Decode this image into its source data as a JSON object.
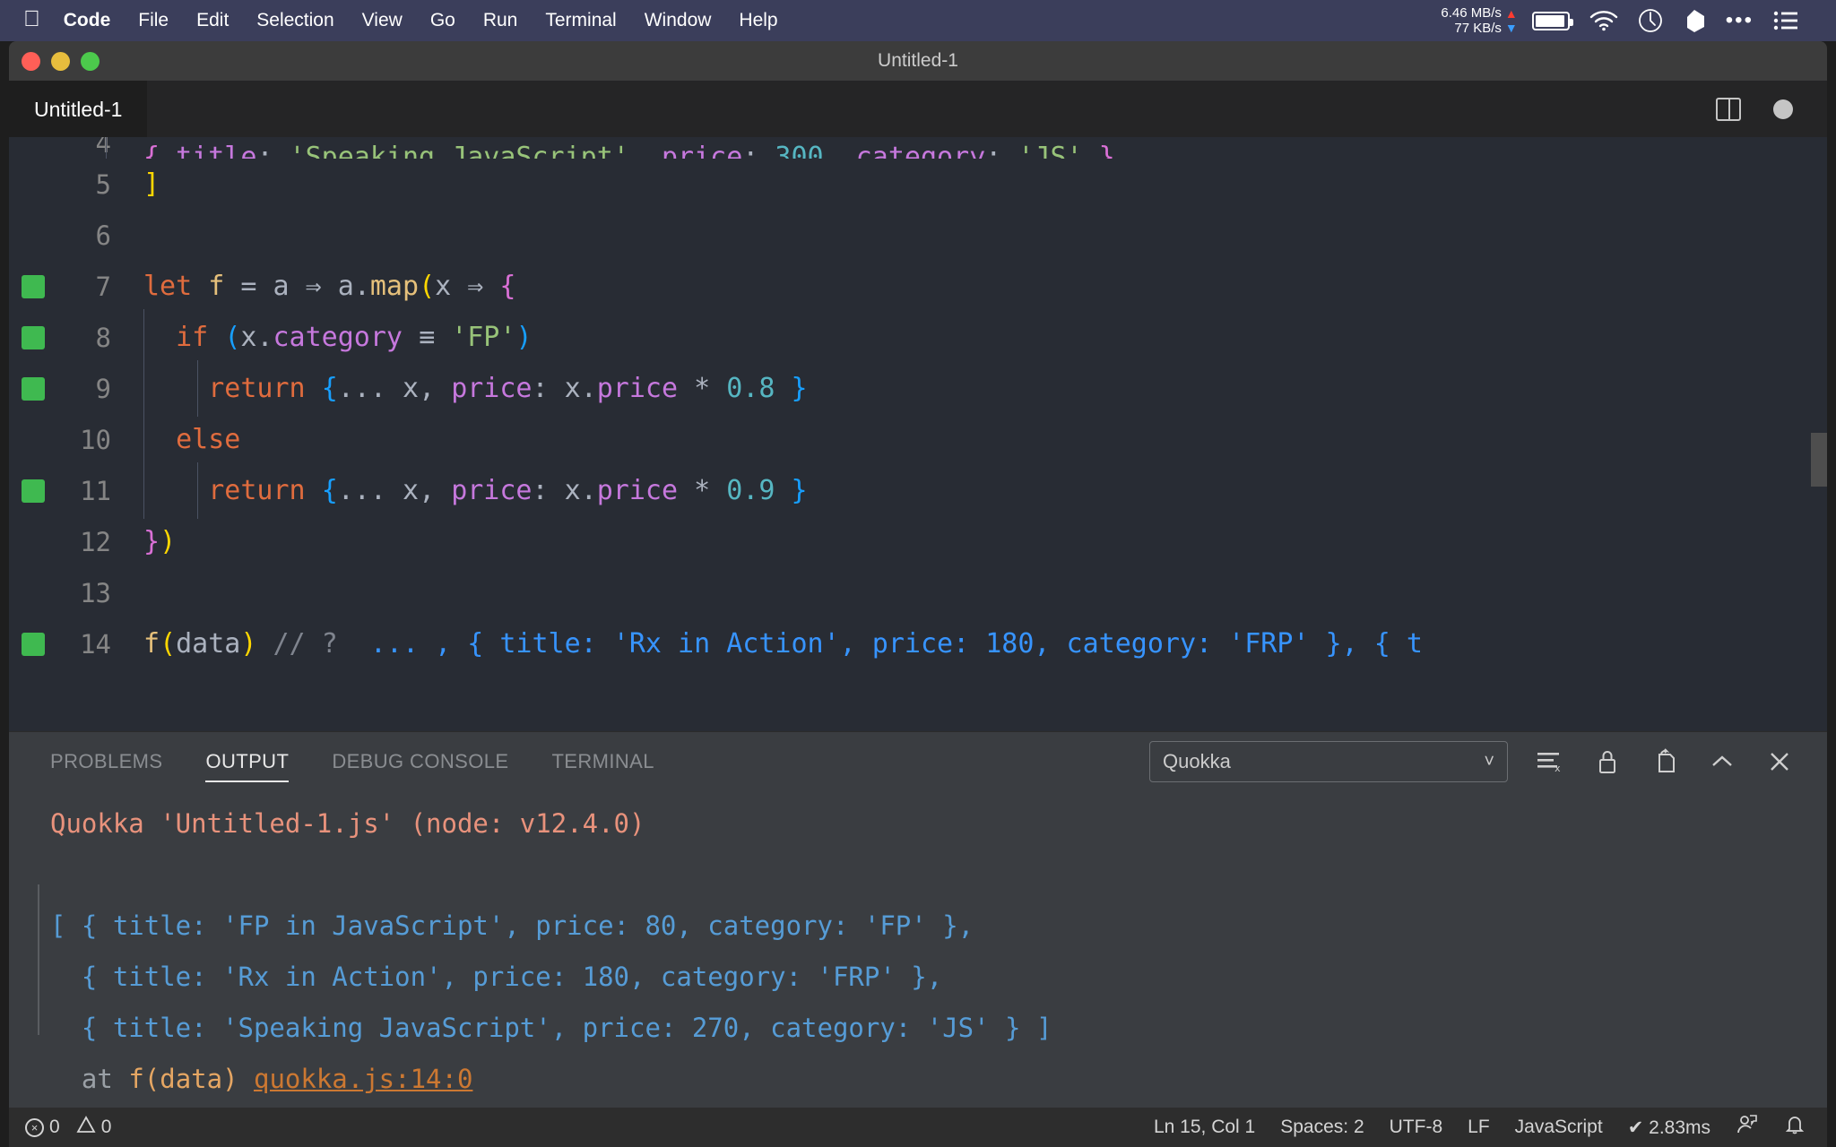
{
  "menubar": {
    "apple_icon": "apple-icon",
    "items": [
      {
        "label": "Code",
        "bold": true
      },
      {
        "label": "File",
        "bold": false
      },
      {
        "label": "Edit",
        "bold": false
      },
      {
        "label": "Selection",
        "bold": false
      },
      {
        "label": "View",
        "bold": false
      },
      {
        "label": "Go",
        "bold": false
      },
      {
        "label": "Run",
        "bold": false
      },
      {
        "label": "Terminal",
        "bold": false
      },
      {
        "label": "Window",
        "bold": false
      },
      {
        "label": "Help",
        "bold": false
      }
    ],
    "network": {
      "up": "6.46 MB/s",
      "down": "77 KB/s"
    },
    "icons": [
      "battery-icon",
      "wifi-icon",
      "clock-icon",
      "dropbox-icon",
      "more-dots-icon",
      "control-center-icon"
    ]
  },
  "window": {
    "title": "Untitled-1",
    "traffic": {
      "close": "close-button",
      "minimize": "minimize-button",
      "zoom": "zoom-button"
    }
  },
  "editor": {
    "tab_label": "Untitled-1",
    "split_icon": "split-editor-icon",
    "dirty_icon": "unsaved-indicator",
    "lines": [
      {
        "num": "4",
        "partial": true,
        "covered": false
      },
      {
        "num": "5",
        "partial": false,
        "covered": false
      },
      {
        "num": "6",
        "partial": false,
        "covered": false
      },
      {
        "num": "7",
        "partial": false,
        "covered": true
      },
      {
        "num": "8",
        "partial": false,
        "covered": true
      },
      {
        "num": "9",
        "partial": false,
        "covered": true
      },
      {
        "num": "10",
        "partial": false,
        "covered": false
      },
      {
        "num": "11",
        "partial": false,
        "covered": true
      },
      {
        "num": "12",
        "partial": false,
        "covered": false
      },
      {
        "num": "13",
        "partial": false,
        "covered": false
      },
      {
        "num": "14",
        "partial": false,
        "covered": true
      }
    ],
    "line14_inline_value": "... , { title: 'Rx in Action', price: 180, category: 'FRP' }, { t",
    "line14_comment": "// ?"
  },
  "panel": {
    "tabs": [
      {
        "label": "PROBLEMS",
        "active": false
      },
      {
        "label": "OUTPUT",
        "active": true
      },
      {
        "label": "DEBUG CONSOLE",
        "active": false
      },
      {
        "label": "TERMINAL",
        "active": false
      }
    ],
    "channel": "Quokka",
    "chevron": "chevron-down-icon",
    "tools": [
      "clear-output-icon",
      "lock-scroll-icon",
      "open-in-editor-icon",
      "maximize-panel-icon",
      "close-panel-icon"
    ],
    "output": {
      "header": "Quokka 'Untitled-1.js' (node: v12.4.0)",
      "lines": [
        "[ { title: 'FP in JavaScript', price: 80, category: 'FP' },",
        "  { title: 'Rx in Action', price: 180, category: 'FRP' },",
        "  { title: 'Speaking JavaScript', price: 270, category: 'JS' } ]"
      ],
      "trace_at": "at ",
      "trace_fn": "f(data) ",
      "trace_link": "quokka.js:14:0"
    }
  },
  "status": {
    "errors": "0",
    "warnings": "0",
    "cursor": "Ln 15, Col 1",
    "spaces": "Spaces: 2",
    "encoding": "UTF-8",
    "eol": "LF",
    "language": "JavaScript",
    "quokka_time": "✔ 2.83ms",
    "feedback_icon": "feedback-icon",
    "bell_icon": "bell-icon"
  },
  "colors": {
    "menubar_bg": "#3b3e5b",
    "editor_bg": "#282c34",
    "panel_bg": "#3a3d41",
    "coverage_green": "#3fb950",
    "link_orange": "#cc7832",
    "value_blue": "#3794ff"
  }
}
